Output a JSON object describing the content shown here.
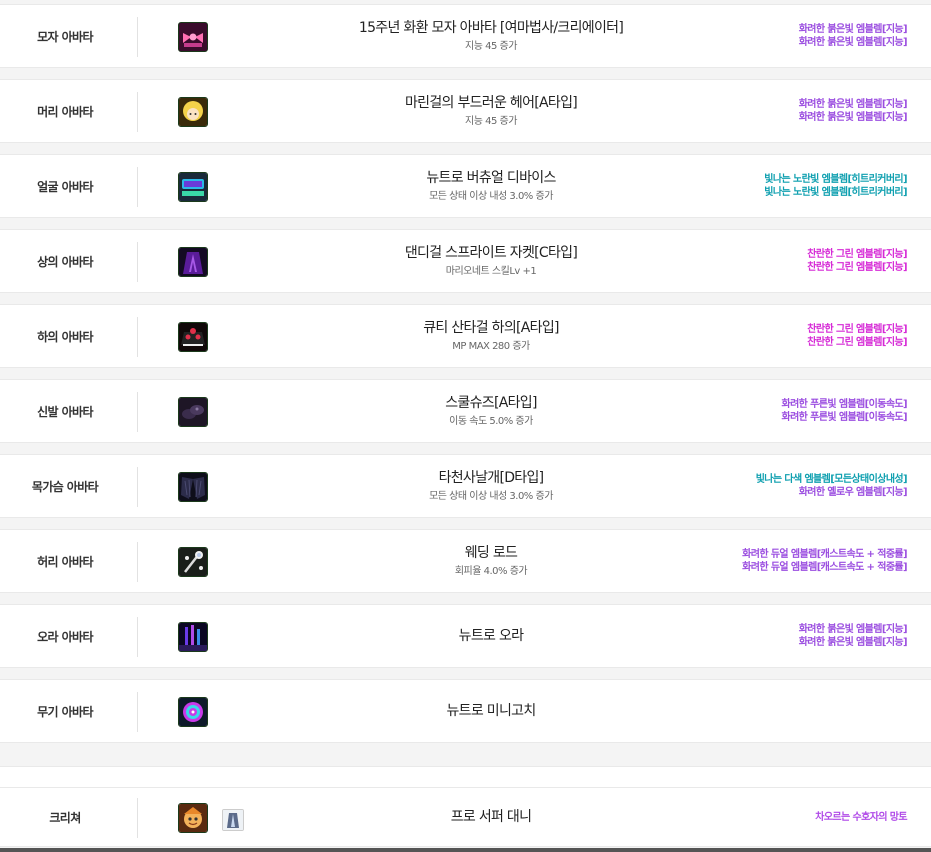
{
  "rows": [
    {
      "slot": "모자 아바타",
      "name": "15주년 화환 모자 아바타 [여마법사/크리에이터]",
      "desc": "지능 45 증가",
      "icon": "pink-ribbon-hat-icon",
      "emblems": [
        {
          "text": "화려한 붉은빛 엠블렘[지능]",
          "tone": "purple"
        },
        {
          "text": "화려한 붉은빛 엠블렘[지능]",
          "tone": "purple"
        }
      ]
    },
    {
      "slot": "머리 아바타",
      "name": "마린걸의 부드러운 헤어[A타입]",
      "desc": "지능 45 증가",
      "icon": "blonde-hair-icon",
      "emblems": [
        {
          "text": "화려한 붉은빛 엠블렘[지능]",
          "tone": "purple"
        },
        {
          "text": "화려한 붉은빛 엠블렘[지능]",
          "tone": "purple"
        }
      ]
    },
    {
      "slot": "얼굴 아바타",
      "name": "뉴트로 버츄얼 디바이스",
      "desc": "모든 상태 이상 내성 3.0% 증가",
      "icon": "virtual-device-icon",
      "emblems": [
        {
          "text": "빛나는 노란빛 엠블렘[히트리커버리]",
          "tone": "teal"
        },
        {
          "text": "빛나는 노란빛 엠블렘[히트리커버리]",
          "tone": "teal"
        }
      ]
    },
    {
      "slot": "상의 아바타",
      "name": "댄디걸 스프라이트 자켓[C타입]",
      "desc": "마리오네트 스킬Lv +1",
      "icon": "purple-jacket-icon",
      "emblems": [
        {
          "text": "찬란한 그린 엠블렘[지능]",
          "tone": "magenta"
        },
        {
          "text": "찬란한 그린 엠블렘[지능]",
          "tone": "magenta"
        }
      ]
    },
    {
      "slot": "하의 아바타",
      "name": "큐티 산타걸 하의[A타입]",
      "desc": "MP MAX 280 증가",
      "icon": "santa-skirt-icon",
      "emblems": [
        {
          "text": "찬란한 그린 엠블렘[지능]",
          "tone": "magenta"
        },
        {
          "text": "찬란한 그린 엠블렘[지능]",
          "tone": "magenta"
        }
      ]
    },
    {
      "slot": "신발 아바타",
      "name": "스쿨슈즈[A타입]",
      "desc": "이동 속도 5.0% 증가",
      "icon": "school-shoes-icon",
      "emblems": [
        {
          "text": "화려한 푸른빛 엠블렘[이동속도]",
          "tone": "purple"
        },
        {
          "text": "화려한 푸른빛 엠블렘[이동속도]",
          "tone": "purple"
        }
      ]
    },
    {
      "slot": "목가슴 아바타",
      "name": "타천사날개[D타입]",
      "desc": "모든 상태 이상 내성 3.0% 증가",
      "icon": "dark-wings-icon",
      "emblems": [
        {
          "text": "빛나는 다색 엠블렘[모든상태이상내성]",
          "tone": "teal"
        },
        {
          "text": "화려한 옐로우 엠블렘[지능]",
          "tone": "purple"
        }
      ]
    },
    {
      "slot": "허리 아바타",
      "name": "웨딩 로드",
      "desc": "회피율 4.0% 증가",
      "icon": "wedding-rod-icon",
      "emblems": [
        {
          "text": "화려한 듀얼 엠블렘[캐스트속도 + 적중률]",
          "tone": "purple"
        },
        {
          "text": "화려한 듀얼 엠블렘[캐스트속도 + 적중률]",
          "tone": "purple"
        }
      ]
    },
    {
      "slot": "오라 아바타",
      "name": "뉴트로 오라",
      "desc": "",
      "icon": "neon-aura-icon",
      "emblems": [
        {
          "text": "화려한 붉은빛 엠블렘[지능]",
          "tone": "purple"
        },
        {
          "text": "화려한 붉은빛 엠블렘[지능]",
          "tone": "purple"
        }
      ]
    },
    {
      "slot": "무기 아바타",
      "name": "뉴트로 미니고치",
      "desc": "",
      "icon": "mini-gochi-icon",
      "emblems": []
    }
  ],
  "creature": {
    "slot": "크리쳐",
    "name": "프로 서퍼 대니",
    "icon": "surfer-danny-icon",
    "artifact_icon": "artifact-icon",
    "emblem": "차오르는 수호자의 망토"
  }
}
